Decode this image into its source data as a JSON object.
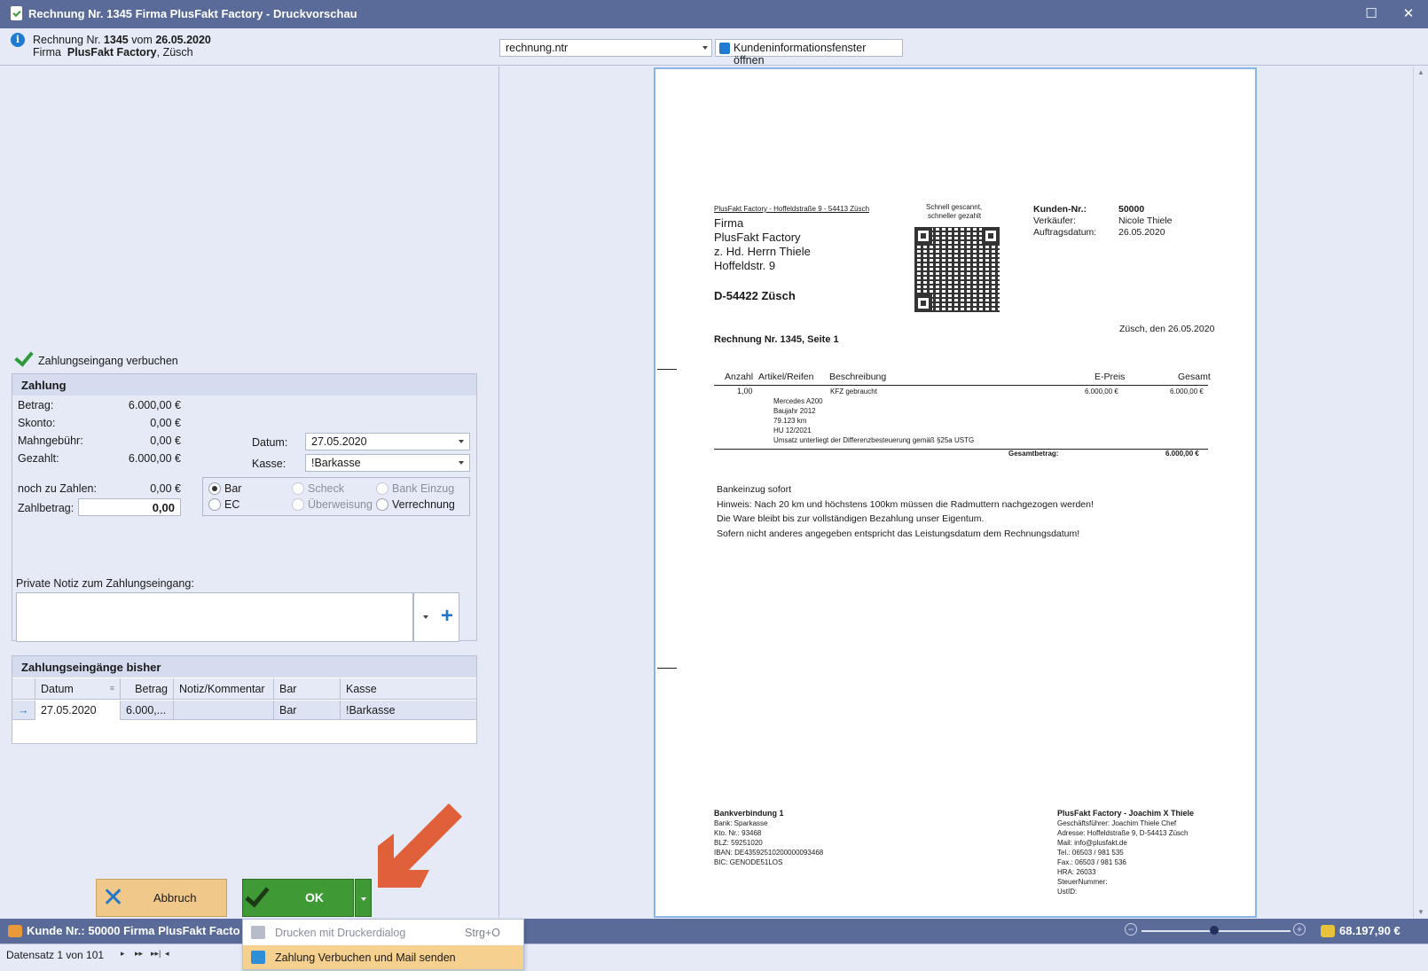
{
  "window": {
    "title": "Rechnung Nr. 1345 Firma PlusFakt Factory - Druckvorschau",
    "maximize": "☐",
    "close": "✕"
  },
  "header": {
    "line1_prefix": "Rechnung Nr.",
    "invoice_no": "1345",
    "line1_mid": "vom",
    "invoice_date": "26.05.2020",
    "line2_prefix": "Firma",
    "company": "PlusFakt Factory",
    "city": ", Züsch",
    "file_select": "rechnung.ntr",
    "kunden_button": "Kundeninformationsfenster öffnen"
  },
  "payment": {
    "book_label": "Zahlungseingang verbuchen",
    "group_title": "Zahlung",
    "betrag_label": "Betrag:",
    "betrag": "6.000,00 €",
    "skonto_label": "Skonto:",
    "skonto": "0,00 €",
    "mahn_label": "Mahngebühr:",
    "mahn": "0,00 €",
    "gezahlt_label": "Gezahlt:",
    "gezahlt": "6.000,00 €",
    "noch_label": "noch zu Zahlen:",
    "noch": "0,00 €",
    "zahlbetrag_label": "Zahlbetrag:",
    "zahlbetrag": "0,00",
    "datum_label": "Datum:",
    "datum": "27.05.2020",
    "kasse_label": "Kasse:",
    "kasse": "!Barkasse",
    "methods": [
      "Bar",
      "Scheck",
      "Bank Einzug",
      "EC",
      "Überweisung",
      "Verrechnung"
    ],
    "selected_method": "Bar",
    "note_label": "Private Notiz zum Zahlungseingang:",
    "note_value": ""
  },
  "history": {
    "title": "Zahlungseingänge bisher",
    "columns": [
      "Datum",
      "Betrag",
      "Notiz/Kommentar",
      "Bar",
      "Kasse"
    ],
    "rows": [
      {
        "datum": "27.05.2020",
        "betrag": "6.000,...",
        "notiz": "",
        "bar": "Bar",
        "kasse": "!Barkasse"
      }
    ]
  },
  "buttons": {
    "abbruch": "Abbruch",
    "ok": "OK"
  },
  "menu": {
    "item1": "Drucken mit Druckerdialog",
    "item1_shortcut": "Strg+O",
    "item2": "Zahlung Verbuchen und Mail senden"
  },
  "invoice": {
    "sender_line": "PlusFakt Factory - Hoffeldstraße 9 - 54413 Züsch",
    "address": [
      "Firma",
      "PlusFakt Factory",
      "z. Hd. Herrn Thiele",
      "Hoffeldstr. 9"
    ],
    "address_city": "D-54422 Züsch",
    "qr_caption1": "Schnell gescannt,",
    "qr_caption2": "schneller gezahlt",
    "kunden_nr_label": "Kunden-Nr.:",
    "kunden_nr": "50000",
    "verkaeufer_label": "Verkäufer:",
    "verkaeufer": "Nicole Thiele",
    "auftragsdatum_label": "Auftragsdatum:",
    "auftragsdatum": "26.05.2020",
    "place_date": "Züsch, den 26.05.2020",
    "heading": "Rechnung Nr. 1345, Seite 1",
    "col_anzahl": "Anzahl",
    "col_artikel": "Artikel/Reifen",
    "col_beschreibung": "Beschreibung",
    "col_epreis": "E-Preis",
    "col_gesamt": "Gesamt",
    "item_qty": "1,00",
    "item_desc": "KFZ gebraucht",
    "item_epreis": "6.000,00 €",
    "item_gesamt": "6.000,00 €",
    "item_details": [
      "Mercedes A200",
      "Baujahr 2012",
      "79.123 km",
      "HU 12/2021",
      "Umsatz unterliegt der Differenzbesteuerung gemäß §25a USTG"
    ],
    "gesamtbetrag_label": "Gesamtbetrag:",
    "gesamtbetrag": "6.000,00 €",
    "notes": [
      "Bankeinzug sofort",
      "Hinweis: Nach 20 km und höchstens 100km müssen die Radmuttern nachgezogen werden!",
      "Die Ware bleibt bis zur vollständigen Bezahlung unser Eigentum.",
      "Sofern nicht anderes angegeben entspricht das Leistungsdatum dem Rechnungsdatum!"
    ],
    "bank_title": "Bankverbindung 1",
    "bank_lines": [
      "Bank: Sparkasse",
      "Kto. Nr.: 93468",
      "BLZ: 59251020",
      "IBAN: DE43592510200000093468",
      "BIC: GENODE51LOS"
    ],
    "company_title": "PlusFakt Factory - Joachim X Thiele",
    "company_lines": [
      "Geschäftsführer: Joachim Thiele Chef",
      "Adresse: Hoffeldstraße 9, D-54413 Züsch",
      "Mail: info@plusfakt.de",
      "Tel.: 06503 / 981 535",
      "Fax.: 06503 / 981 536",
      "HRA: 26033",
      "SteuerNummer:",
      "UstID:"
    ]
  },
  "status": {
    "kunde": "Kunde  Nr.: 50000 Firma  PlusFakt Facto",
    "total": "68.197,90 €",
    "zoom_minus": "−",
    "zoom_plus": "+"
  },
  "navigator": {
    "text": "Datensatz 1 von 101"
  },
  "colors": {
    "titlebar": "#5a6b9a",
    "panel": "#e6eaf7",
    "ok_green": "#3f9a36",
    "abbruch_orange": "#f0c889",
    "arrow": "#e0603a"
  }
}
